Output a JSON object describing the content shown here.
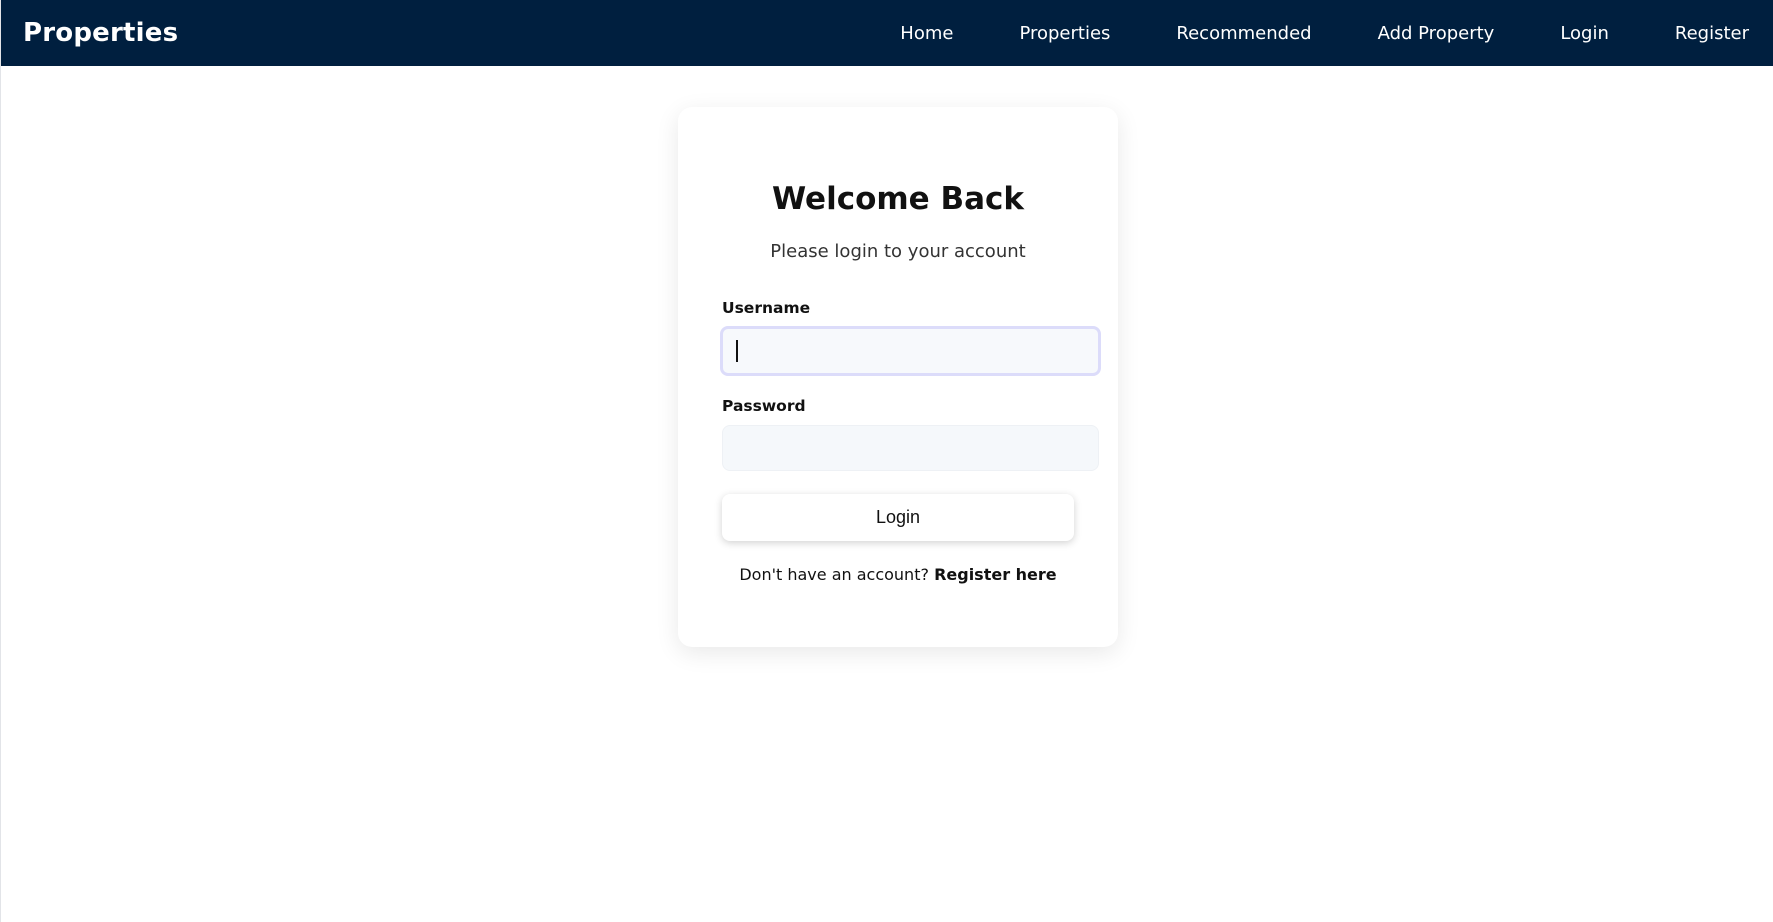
{
  "navbar": {
    "brand": "Properties",
    "links": [
      "Home",
      "Properties",
      "Recommended",
      "Add Property",
      "Login",
      "Register"
    ]
  },
  "login_card": {
    "title": "Welcome Back",
    "subtitle": "Please login to your account",
    "username_label": "Username",
    "username_value": "",
    "password_label": "Password",
    "password_value": "",
    "login_button": "Login",
    "register_prompt": "Don't have an account?",
    "register_link": "Register here"
  },
  "colors": {
    "navbar_bg": "#001f3f",
    "card_bg": "#ffffff",
    "input_bg": "#f5f8fb",
    "focus_ring": "#dcdcfa"
  }
}
